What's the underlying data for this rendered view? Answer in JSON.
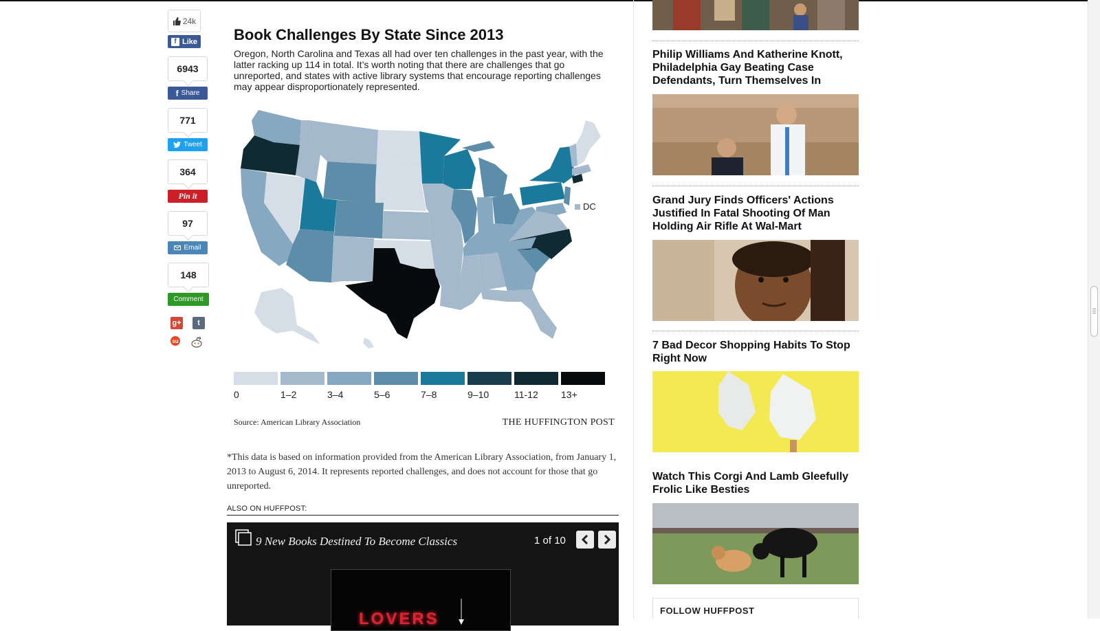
{
  "share": {
    "likes": "24k",
    "like_label": "Like",
    "facebook_count": "6943",
    "share_label": "Share",
    "twitter_count": "771",
    "tweet_label": "Tweet",
    "pinterest_count": "364",
    "pin_label": "Pin it",
    "email_count": "97",
    "email_label": "Email",
    "comment_count": "148",
    "comment_label": "Comment"
  },
  "graphic": {
    "title": "Book Challenges By State Since 2013",
    "dek": "Oregon, North Carolina and Texas all had over ten challenges in the past year, with the latter racking up 114 in total. It’s worth noting that there are challenges that go unreported, and states with active library systems that encourage reporting challenges may appear disproportionately represented.",
    "dc_label": "DC",
    "legend": [
      {
        "label": "0",
        "color": "#d5dee6"
      },
      {
        "label": "1–2",
        "color": "#a4b9cb"
      },
      {
        "label": "3–4",
        "color": "#86a8c0"
      },
      {
        "label": "5–6",
        "color": "#5c8eaa"
      },
      {
        "label": "7–8",
        "color": "#1b7a9c"
      },
      {
        "label": "9–10",
        "color": "#1a3d4d"
      },
      {
        "label": "11-12",
        "color": "#102a33"
      },
      {
        "label": "13+",
        "color": "#080b0d"
      }
    ],
    "source": "Source: American Library Association",
    "credit": "THE HUFFINGTON POST"
  },
  "footnote": "*This data is based on information provided from the American Library Association, from January 1, 2013 to August 6, 2014. It represents reported challenges, and does not account for those that go unreported.",
  "also_label": "ALSO ON HUFFPOST:",
  "slideshow": {
    "title": "9 New Books Destined To Become Classics",
    "current": "1",
    "of_label": "of",
    "total": "10",
    "neon": "LOVERS"
  },
  "sidebar": {
    "stories": [
      {
        "title": "Philip Williams And Katherine Knott, Philadelphia Gay Beating Case Defendants, Turn Themselves In"
      },
      {
        "title": "Grand Jury Finds Officers' Actions Justified In Fatal Shooting Of Man Holding Air Rifle At Wal-Mart"
      },
      {
        "title": "7 Bad Decor Shopping Habits To Stop Right Now"
      },
      {
        "title": "Watch This Corgi And Lamb Gleefully Frolic Like Besties"
      }
    ],
    "follow_label": "FOLLOW HUFFPOST"
  },
  "colors": {
    "facebook": "#3b5998",
    "twitter": "#1da1f2",
    "pinterest": "#cb2027",
    "email": "#4a86b8",
    "comment": "#2e9a25"
  }
}
